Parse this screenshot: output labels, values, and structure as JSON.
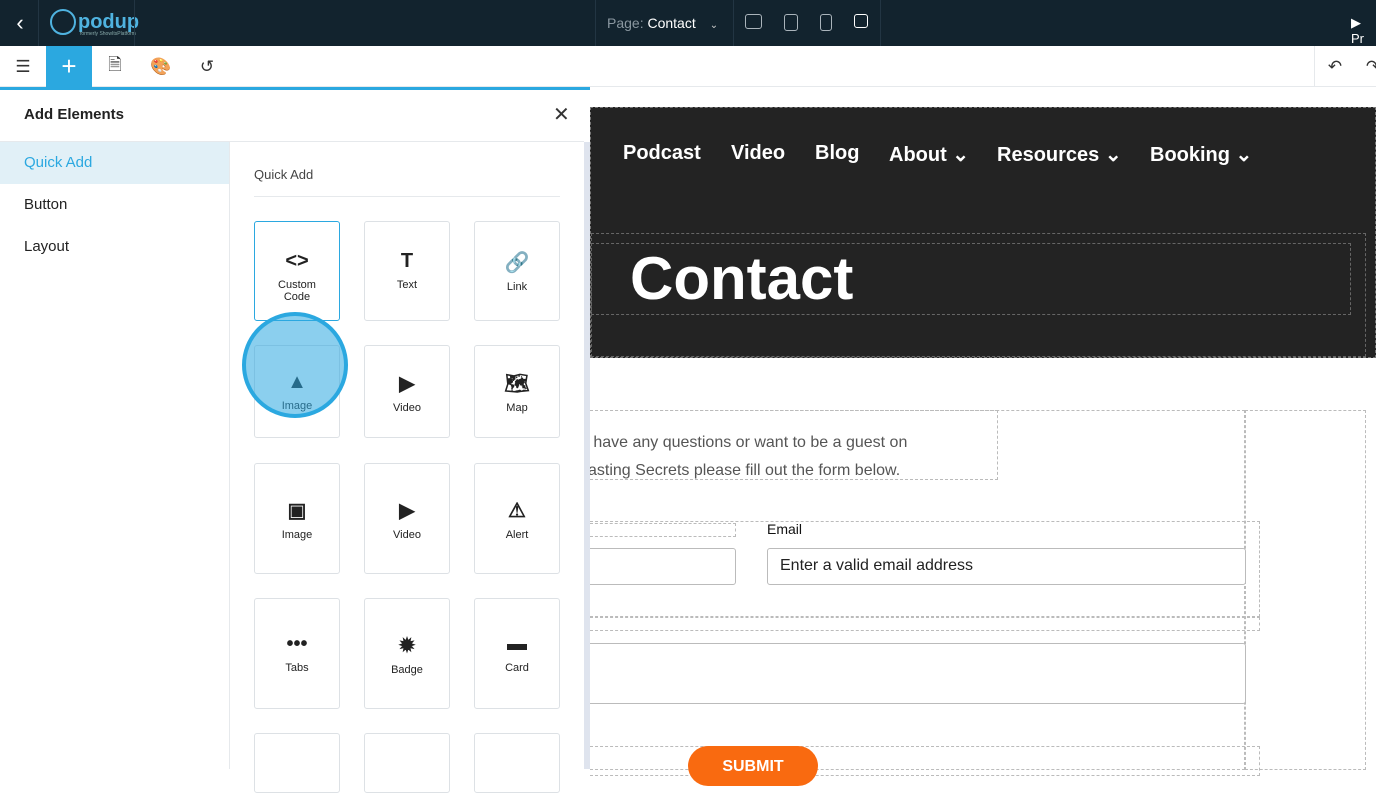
{
  "topbar": {
    "back": "‹",
    "logo": "podup",
    "logo_tagline": "formerly ShowItsPlatform",
    "page_label": "Page:",
    "page_value": "Contact",
    "preview": "▶ Pr"
  },
  "panel": {
    "title": "Add Elements",
    "nav": [
      "Quick Add",
      "Button",
      "Layout"
    ],
    "section": "Quick Add",
    "elements": [
      {
        "label": "Custom Code",
        "icon": "<>"
      },
      {
        "label": "Text",
        "icon": "T"
      },
      {
        "label": "Link",
        "icon": "🔗"
      },
      {
        "label": "Image",
        "icon": "▲"
      },
      {
        "label": "Video",
        "icon": "▶"
      },
      {
        "label": "Map",
        "icon": "🗺"
      },
      {
        "label": "Image",
        "icon": "▣"
      },
      {
        "label": "Video",
        "icon": "▶"
      },
      {
        "label": "Alert",
        "icon": "⚠"
      },
      {
        "label": "Tabs",
        "icon": "•••"
      },
      {
        "label": "Badge",
        "icon": "✹"
      },
      {
        "label": "Card",
        "icon": "▬"
      },
      {
        "label": "",
        "icon": ""
      },
      {
        "label": "",
        "icon": ""
      },
      {
        "label": "",
        "icon": ""
      }
    ]
  },
  "canvas": {
    "menu": [
      "Podcast",
      "Video",
      "Blog",
      "About ⌄",
      "Resources ⌄",
      "Booking ⌄"
    ],
    "title": "Contact",
    "intro_line1": "u have any questions or want to be a guest on",
    "intro_line2": "casting Secrets please fill out the form below.",
    "email_label": "Email",
    "email_placeholder": "Enter a valid email address",
    "submit": "SUBMIT"
  },
  "colors": {
    "accent": "#2ba8e0",
    "topbar": "#12232e",
    "submit": "#f96a10"
  }
}
